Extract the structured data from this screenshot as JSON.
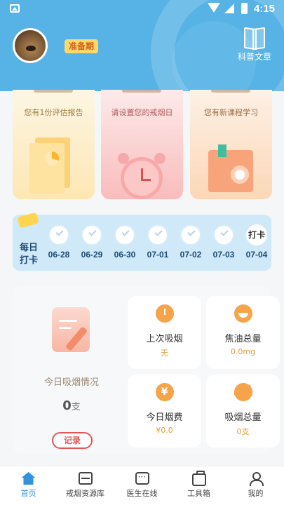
{
  "status_bar": {
    "time": "4:15"
  },
  "header": {
    "status_badge": "准备期",
    "science_label": "科普文章"
  },
  "cards": [
    {
      "desc": "您有1份评估报告"
    },
    {
      "desc": "请设置您的戒烟日"
    },
    {
      "desc": "您有新课程学习"
    }
  ],
  "checkin": {
    "title_line1": "每日",
    "title_line2": "打卡",
    "days": [
      {
        "date": "06-28"
      },
      {
        "date": "06-29"
      },
      {
        "date": "06-30"
      },
      {
        "date": "07-01"
      },
      {
        "date": "07-02"
      },
      {
        "date": "07-03"
      },
      {
        "date": "07-04",
        "button": "打卡"
      }
    ]
  },
  "today": {
    "title": "今日吸烟情况",
    "count": "0",
    "unit": "支",
    "record_label": "记录"
  },
  "stats": [
    {
      "label": "上次吸烟",
      "value": "无"
    },
    {
      "label": "焦油总量",
      "value": "0.0mg"
    },
    {
      "label": "今日烟费",
      "value": "¥0.0",
      "icon_glyph": "¥"
    },
    {
      "label": "吸烟总量",
      "value": "0支"
    }
  ],
  "tabs": [
    {
      "label": "首页",
      "active": true
    },
    {
      "label": "戒烟资源库"
    },
    {
      "label": "医生在线"
    },
    {
      "label": "工具箱"
    },
    {
      "label": "我的"
    }
  ],
  "colors": {
    "header_blue": "#57b3e6",
    "active_tab": "#2f93dd",
    "record_red": "#e25656",
    "stat_orange": "#f6a34a"
  }
}
